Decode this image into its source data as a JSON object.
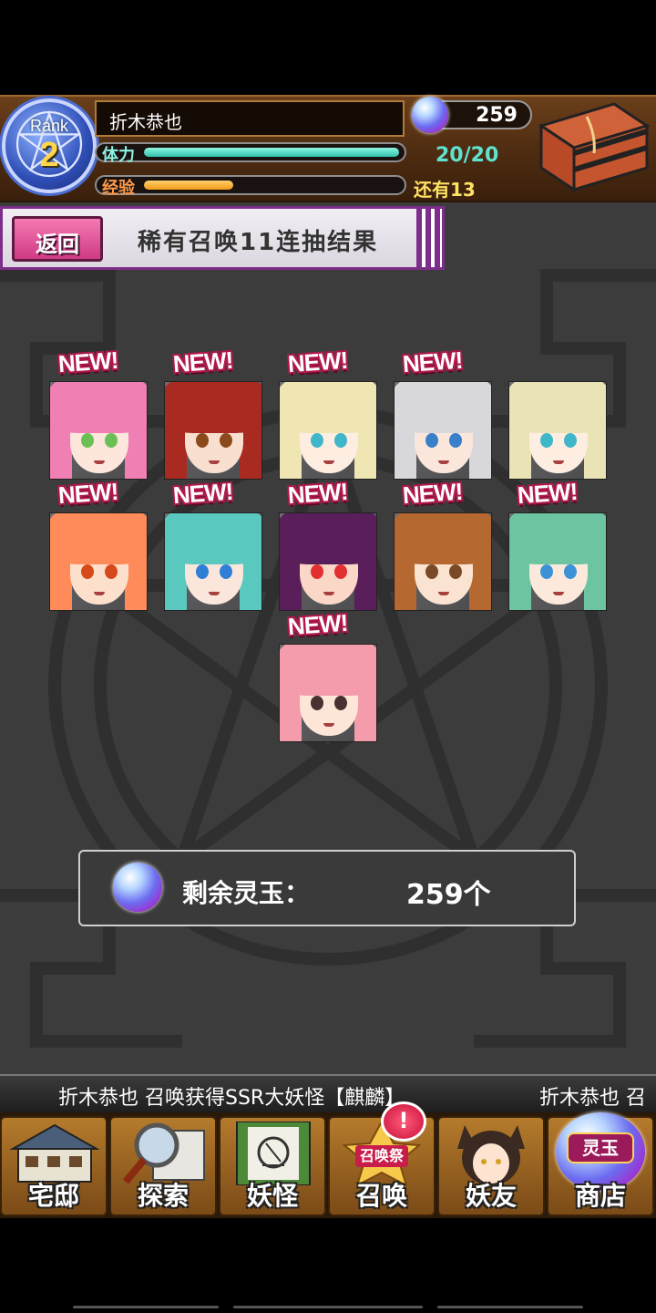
{
  "header": {
    "rank_label": "Rank",
    "rank_value": "2",
    "player_name": "折木恭也",
    "gems": "259",
    "stamina_label": "体力",
    "stamina_value": "20/20",
    "stamina_fraction": 1.0,
    "exp_label": "经验",
    "exp_remaining": "还有13",
    "exp_fraction": 0.35
  },
  "titlebar": {
    "back_label": "返回",
    "title": "稀有召唤11连抽结果"
  },
  "results": [
    {
      "new": "NEW!",
      "hair": "#f07fb4",
      "eye": "#6bbf55",
      "skin": "#fde6dc"
    },
    {
      "new": "NEW!",
      "hair": "#a92a20",
      "eye": "#8a4a1c",
      "skin": "#f9dfcf"
    },
    {
      "new": "NEW!",
      "hair": "#efe6b4",
      "eye": "#3fb6c9",
      "skin": "#fdeee1"
    },
    {
      "new": "NEW!",
      "hair": "#d7d7dc",
      "eye": "#3a7fc9",
      "skin": "#fbe6db"
    },
    {
      "new": "",
      "hair": "#eae3b6",
      "eye": "#3fb6c9",
      "skin": "#fdeee1"
    },
    {
      "new": "NEW!",
      "hair": "#ff8a5a",
      "eye": "#d64a1a",
      "skin": "#fde0cc"
    },
    {
      "new": "NEW!",
      "hair": "#59c9c0",
      "eye": "#2f7fd6",
      "skin": "#fbe6dc"
    },
    {
      "new": "NEW!",
      "hair": "#5a1f5a",
      "eye": "#e23030",
      "skin": "#fbd7c7"
    },
    {
      "new": "NEW!",
      "hair": "#b5682f",
      "eye": "#7a4a28",
      "skin": "#fbe3d2"
    },
    {
      "new": "NEW!",
      "hair": "#6cc4a0",
      "eye": "#3b93d6",
      "skin": "#fde8dc"
    },
    {
      "new": "NEW!",
      "hair": "#f59cac",
      "eye": "#4a3030",
      "skin": "#fde6d8"
    }
  ],
  "remaining": {
    "label": "剩余灵玉：",
    "value": "259个"
  },
  "ticker": {
    "message": "折木恭也 召唤获得SSR大妖怪【麒麟】",
    "message_repeat": "折木恭也 召"
  },
  "nav": {
    "items": [
      {
        "label": "宅邸",
        "icon": "house-icon"
      },
      {
        "label": "探索",
        "icon": "magnifier-map-icon"
      },
      {
        "label": "妖怪",
        "icon": "scroll-yokai-icon"
      },
      {
        "label": "召唤",
        "icon": "summon-festival-icon",
        "badge": "召唤祭"
      },
      {
        "label": "妖友",
        "icon": "fox-girl-icon"
      },
      {
        "label": "商店",
        "icon": "spirit-orb-icon",
        "badge": "灵玉"
      }
    ],
    "alert": "!"
  },
  "colors": {
    "background": "#3c3c3d",
    "header_brown": "#4b2a10",
    "title_border": "#7d2e8a",
    "back_button": "#e05a9a",
    "stamina": "#2ec2ad",
    "exp": "#f29a1a"
  }
}
